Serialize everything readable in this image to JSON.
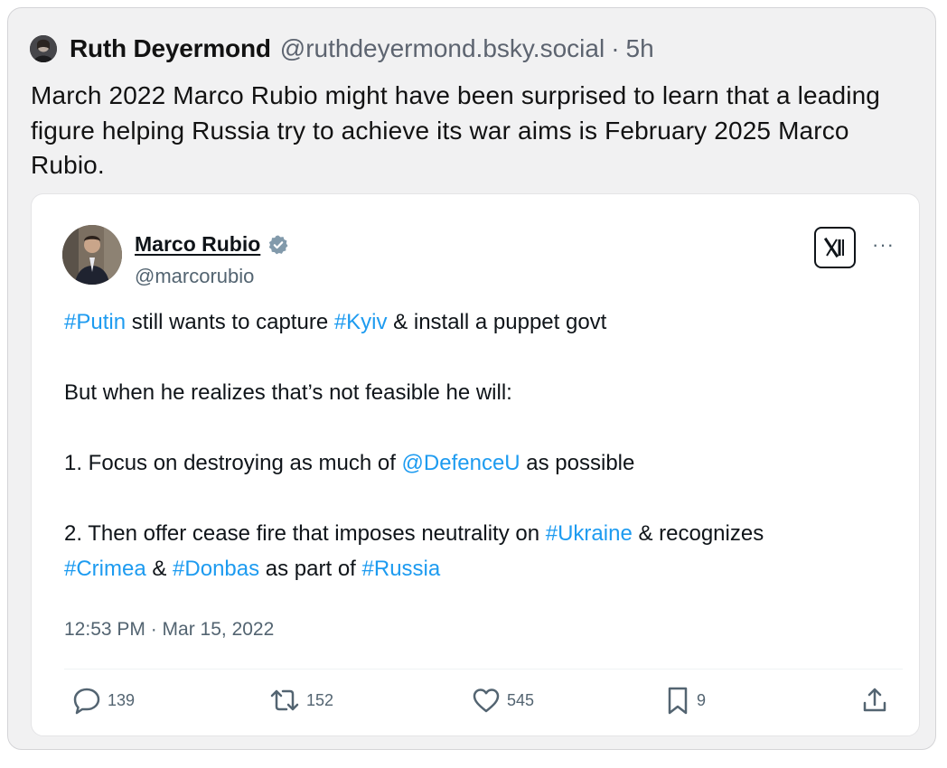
{
  "post": {
    "author_name": "Ruth Deyermond",
    "author_handle": "@ruthdeyermond.bsky.social",
    "separator": "·",
    "time": "5h",
    "text": "March 2022 Marco Rubio might have been surprised to learn that a leading figure helping Russia try to achieve its war aims is February 2025 Marco Rubio."
  },
  "embed": {
    "name": "Marco Rubio",
    "handle": "@marcorubio",
    "more_label": "···",
    "line1": {
      "tag1": "#Putin",
      "text1": " still wants to capture ",
      "tag2": "#Kyiv",
      "text2": " & install a puppet govt"
    },
    "line2": "But when he realizes that’s not feasible he will:",
    "line3": {
      "text1": "1. Focus on destroying as much of ",
      "tag1": "@DefenceU",
      "text2": " as possible"
    },
    "line4": {
      "text1": "2. Then offer cease fire that imposes neutrality on ",
      "tag1": "#Ukraine",
      "text2": " & recognizes"
    },
    "line5": {
      "tag1": "#Crimea",
      "text1": " & ",
      "tag2": "#Donbas",
      "text2": " as part of ",
      "tag3": "#Russia"
    },
    "timestamp": "12:53 PM · Mar 15, 2022",
    "actions": {
      "replies": "139",
      "reposts": "152",
      "likes": "545",
      "bookmarks": "9"
    }
  },
  "colors": {
    "link": "#1d9bf0",
    "verified": "#829aab",
    "card_bg": "#f1f1f2"
  },
  "icons": [
    "reply-icon",
    "repost-icon",
    "like-icon",
    "bookmark-icon",
    "share-icon",
    "verified-badge-icon",
    "x-logo-icon",
    "more-icon"
  ]
}
